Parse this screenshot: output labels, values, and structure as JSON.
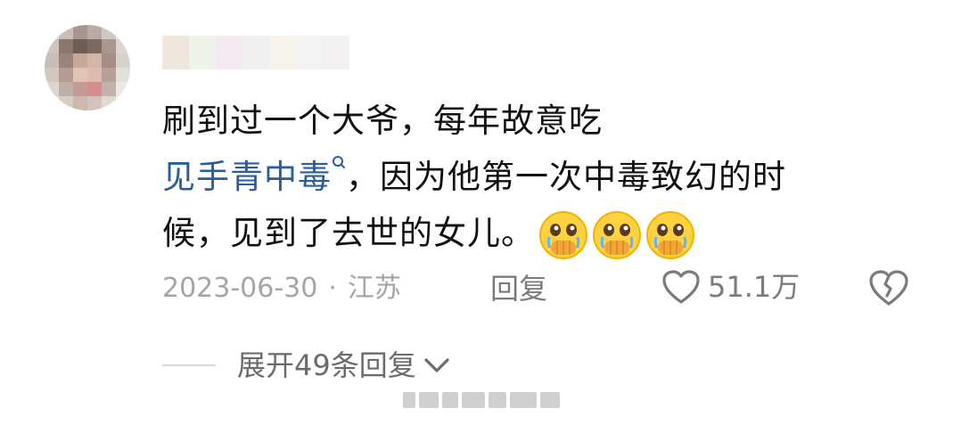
{
  "comment": {
    "text_line1": "刷到过一个大爷，每年故意吃",
    "link_text": "见手青中毒",
    "text_line2_rest": "，因为他第一次中毒致幻的时",
    "text_line3": "候，见到了去世的女儿。",
    "emoji_name": "crying-hands-over-mouth-emoji",
    "emoji_count": 3
  },
  "meta": {
    "date": "2023-06-30",
    "separator": "·",
    "location": "江苏",
    "reply_label": "回复",
    "like_count": "51.1万"
  },
  "expand": {
    "label": "展开49条回复"
  },
  "colors": {
    "link": "#2a5d99",
    "meta": "#a5a5a5",
    "text": "#111111"
  }
}
